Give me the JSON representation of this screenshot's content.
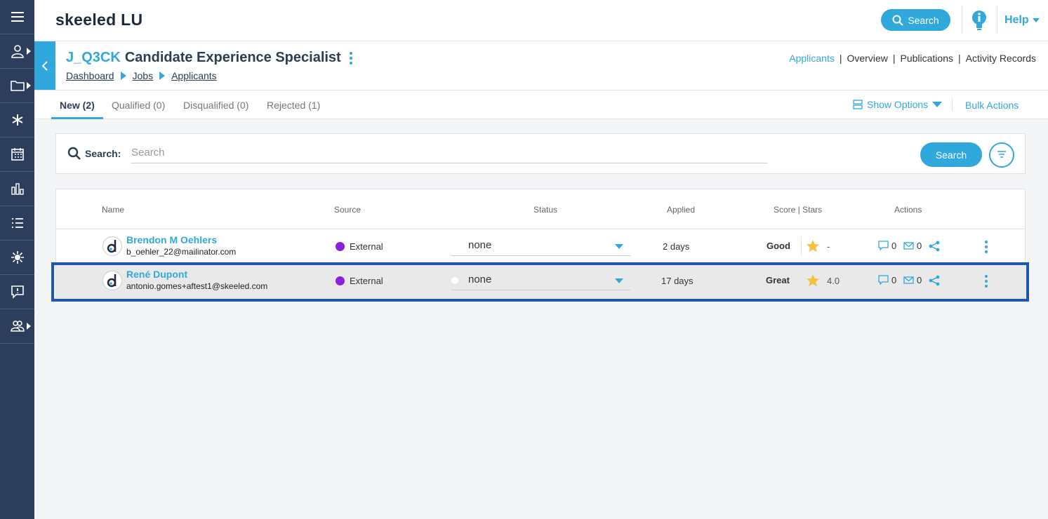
{
  "app": {
    "title": "skeeled LU"
  },
  "topbar": {
    "search_label": "Search",
    "help_label": "Help"
  },
  "sidebar": {
    "items": [
      {
        "icon": "hamburger-menu-icon"
      },
      {
        "icon": "user-icon"
      },
      {
        "icon": "folder-icon"
      },
      {
        "icon": "asterisk-icon"
      },
      {
        "icon": "calendar-icon"
      },
      {
        "icon": "bar-chart-icon"
      },
      {
        "icon": "list-icon"
      },
      {
        "icon": "virus-icon"
      },
      {
        "icon": "feedback-icon"
      },
      {
        "icon": "team-icon"
      }
    ]
  },
  "job": {
    "code": "J_Q3CK",
    "title": "Candidate Experience Specialist",
    "breadcrumb": [
      "Dashboard",
      "Jobs",
      "Applicants"
    ],
    "nav": [
      "Applicants",
      "Overview",
      "Publications",
      "Activity Records"
    ]
  },
  "tabs": [
    {
      "label": "New (2)",
      "active": true
    },
    {
      "label": "Qualified (0)"
    },
    {
      "label": "Disqualified (0)"
    },
    {
      "label": "Rejected (1)"
    }
  ],
  "options": {
    "show_options": "Show Options",
    "bulk_actions": "Bulk Actions"
  },
  "search": {
    "label": "Search:",
    "placeholder": "Search",
    "button": "Search"
  },
  "table": {
    "headers": [
      "Name",
      "Source",
      "Status",
      "Applied",
      "Score | Stars",
      "Actions"
    ],
    "rows": [
      {
        "name": "Brendon M Oehlers",
        "email": "b_oehler_22@mailinator.com",
        "source": "External",
        "status": "none",
        "applied": "2 days",
        "score": "Good",
        "stars": "-",
        "comments": "0",
        "messages": "0"
      },
      {
        "name": "René Dupont",
        "email": "antonio.gomes+aftest1@skeeled.com",
        "source": "External",
        "status": "none",
        "applied": "17 days",
        "score": "Great",
        "stars": "4.0",
        "comments": "0",
        "messages": "0"
      }
    ]
  },
  "colors": {
    "accent": "#30a8dc",
    "sidebar": "#2c3e5c",
    "source_dot": "#8a1fe0",
    "star": "#f5c242",
    "highlight": "#1f56ae"
  }
}
